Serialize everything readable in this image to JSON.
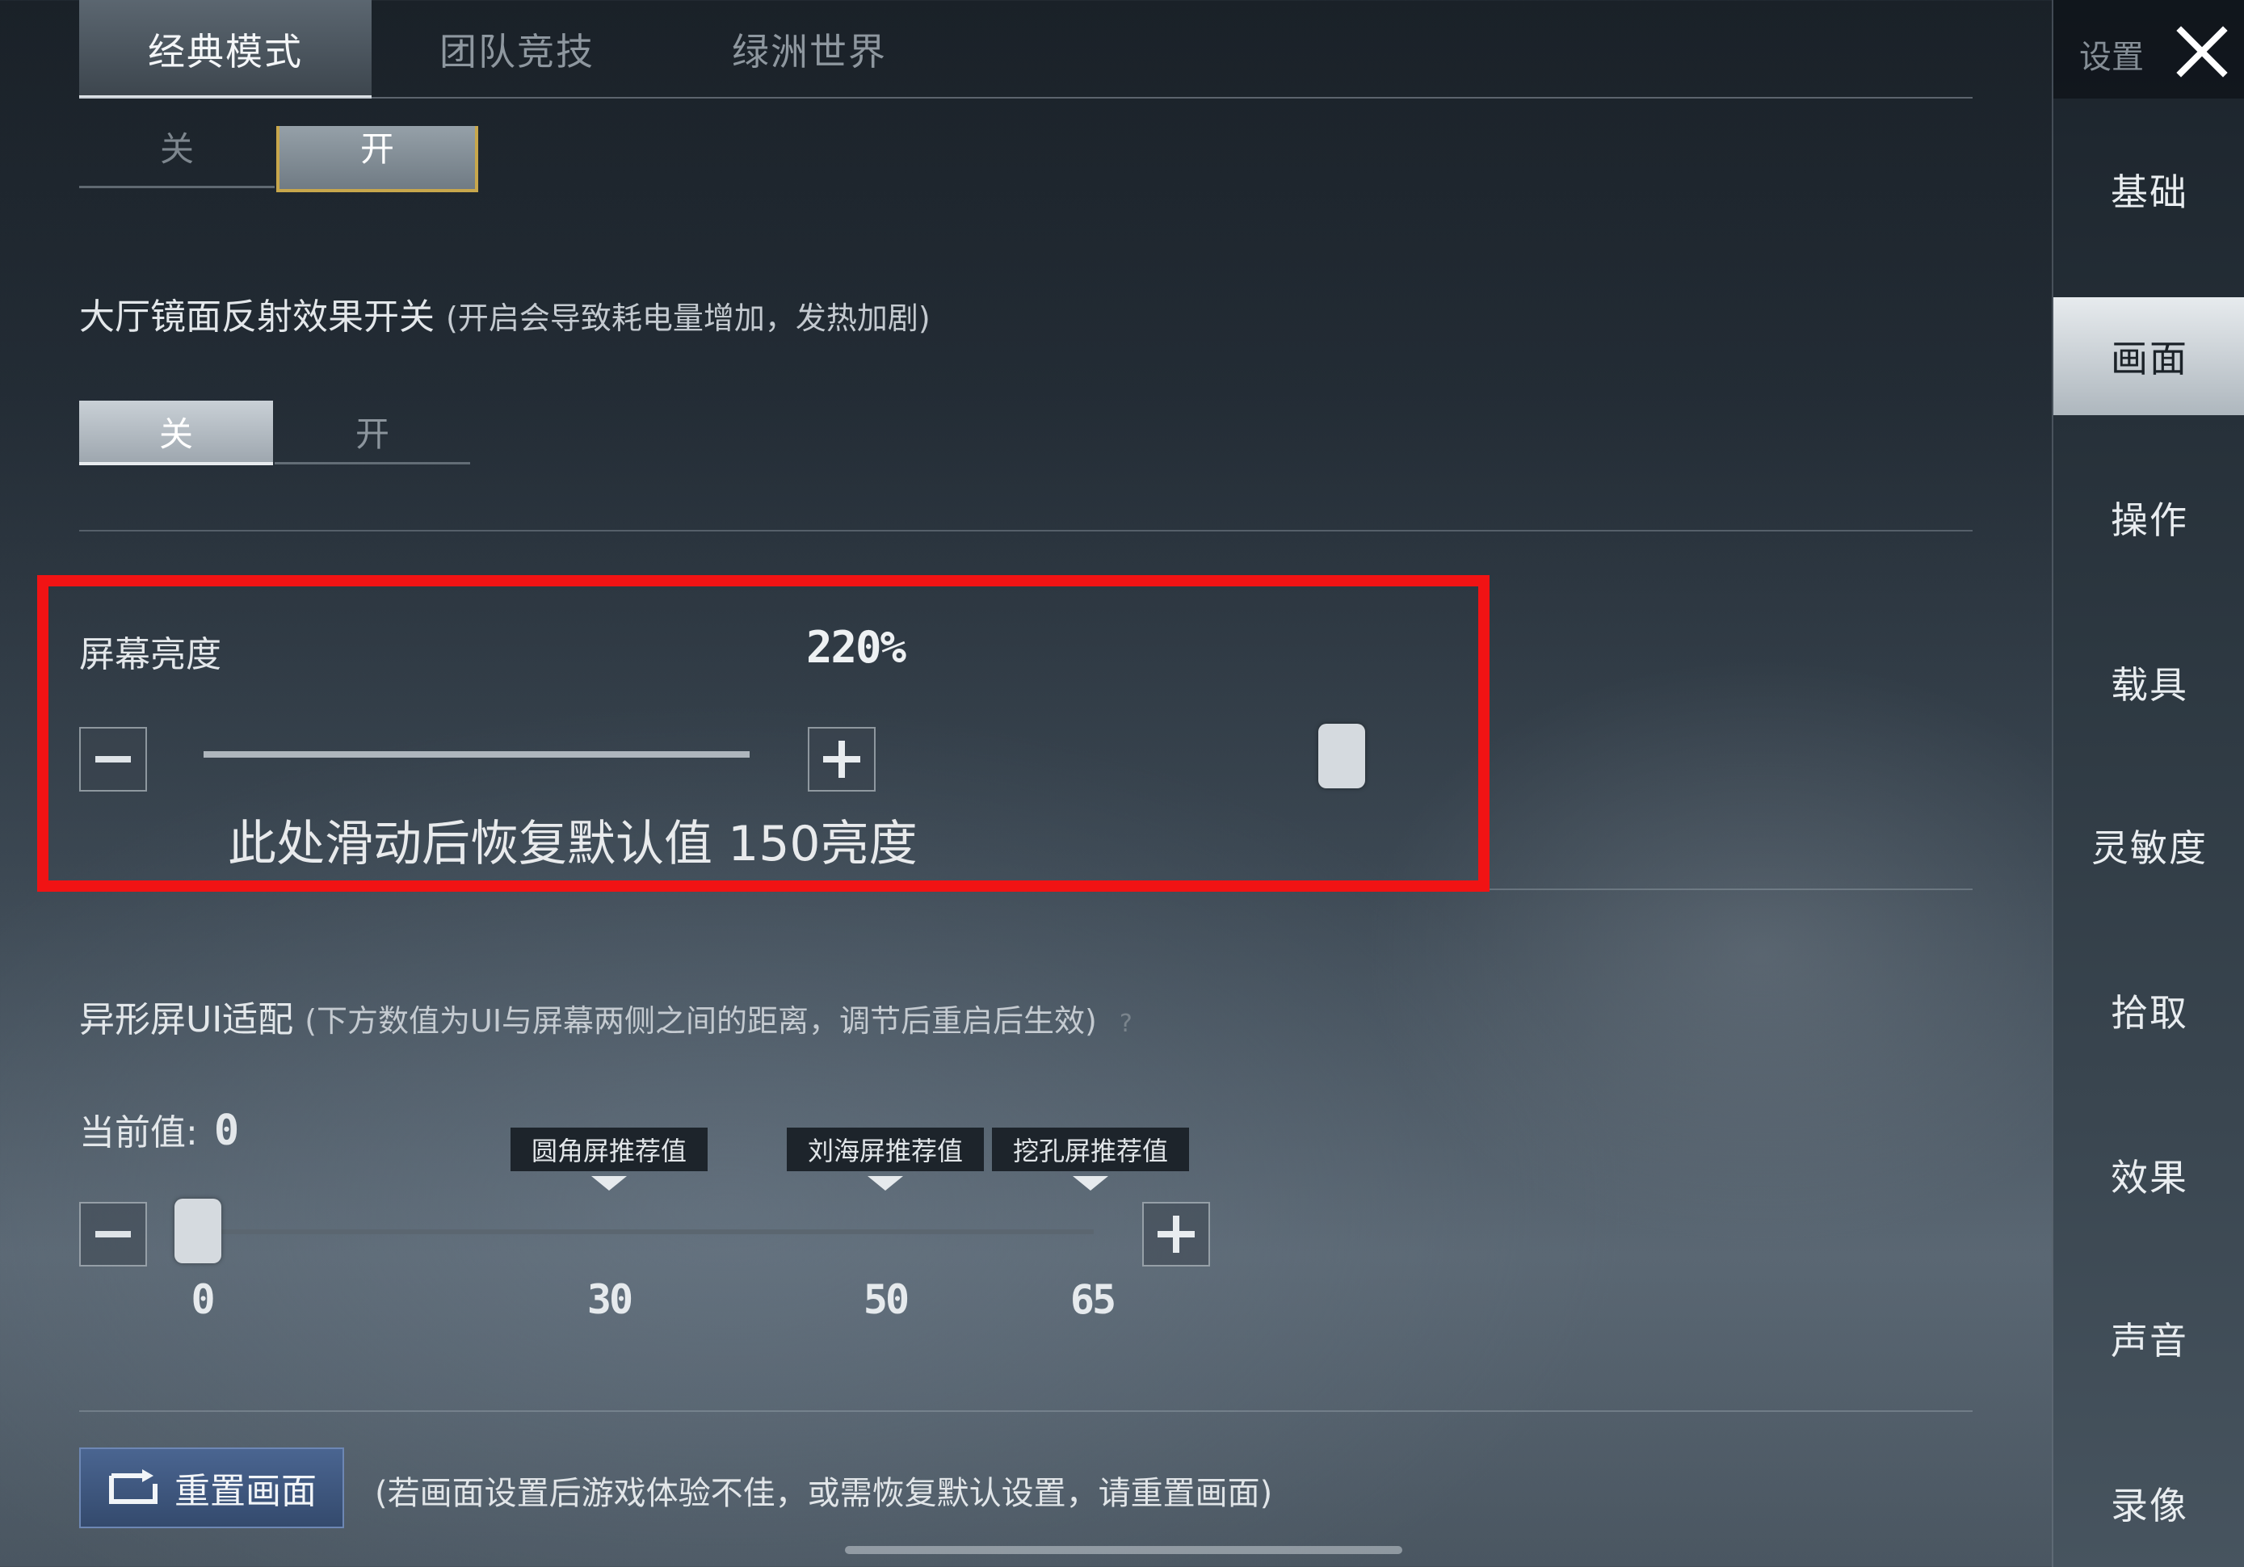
{
  "top_tabs": [
    {
      "label": "经典模式",
      "active": true
    },
    {
      "label": "团队竞技",
      "active": false
    },
    {
      "label": "绿洲世界",
      "active": false
    }
  ],
  "header": {
    "settings_label": "设置",
    "close_icon": "close-x-icon"
  },
  "partial_toggle": {
    "off_label": "关",
    "on_label": "开",
    "selected": "on"
  },
  "reflection": {
    "title": "大厅镜面反射效果开关",
    "note": "(开启会导致耗电量增加，发热加剧)",
    "off_label": "关",
    "on_label": "开",
    "selected": "off"
  },
  "brightness": {
    "title": "屏幕亮度",
    "value_text": "220%",
    "slider_fraction": 1.0,
    "annotation": "此处滑动后恢复默认值 150亮度",
    "highlight_color": "#f11314"
  },
  "notch": {
    "title": "异形屏UI适配",
    "note": "(下方数值为UI与屏幕两侧之间的距离，调节后重启后生效)",
    "help_icon": "question-icon",
    "current_label": "当前值:",
    "current_value": "0",
    "slider_value": 0,
    "slider_range": [
      0,
      65
    ],
    "ticks": [
      "0",
      "30",
      "50",
      "65"
    ],
    "tags": [
      "圆角屏推荐值",
      "刘海屏推荐值",
      "挖孔屏推荐值"
    ]
  },
  "reset": {
    "button_label": "重置画面",
    "note": "(若画面设置后游戏体验不佳，或需恢复默认设置，请重置画面)"
  },
  "sidebar": {
    "items": [
      {
        "label": "基础",
        "active": false
      },
      {
        "label": "画面",
        "active": true
      },
      {
        "label": "操作",
        "active": false
      },
      {
        "label": "载具",
        "active": false
      },
      {
        "label": "灵敏度",
        "active": false
      },
      {
        "label": "拾取",
        "active": false
      },
      {
        "label": "效果",
        "active": false
      },
      {
        "label": "声音",
        "active": false
      },
      {
        "label": "录像",
        "active": false
      }
    ]
  }
}
